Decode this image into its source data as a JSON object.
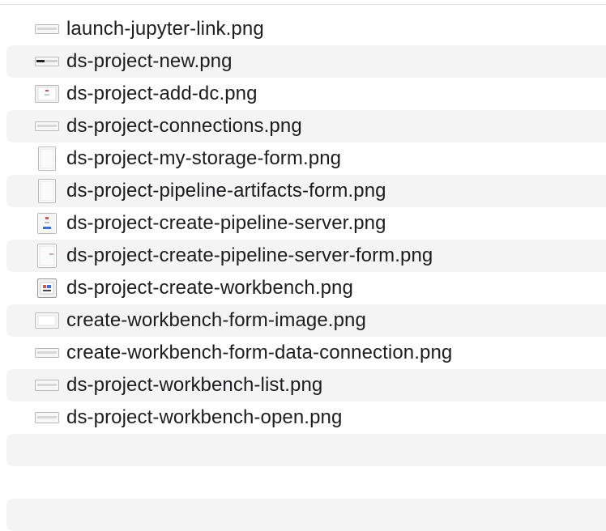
{
  "files": [
    {
      "name": "launch-jupyter-link.png",
      "icon": "wide-screenshot-thumbnail-icon"
    },
    {
      "name": "ds-project-new.png",
      "icon": "wide-dark-bar-thumbnail-icon"
    },
    {
      "name": "ds-project-add-dc.png",
      "icon": "dialog-thumbnail-icon"
    },
    {
      "name": "ds-project-connections.png",
      "icon": "wide-screenshot-thumbnail-icon"
    },
    {
      "name": "ds-project-my-storage-form.png",
      "icon": "tall-form-thumbnail-icon"
    },
    {
      "name": "ds-project-pipeline-artifacts-form.png",
      "icon": "tall-form-thumbnail-icon"
    },
    {
      "name": "ds-project-create-pipeline-server.png",
      "icon": "small-dialog-thumbnail-icon"
    },
    {
      "name": "ds-project-create-pipeline-server-form.png",
      "icon": "tall-form-thumbnail-icon"
    },
    {
      "name": "ds-project-create-workbench.png",
      "icon": "colorful-dialog-thumbnail-icon"
    },
    {
      "name": "create-workbench-form-image.png",
      "icon": "window-thumbnail-icon"
    },
    {
      "name": "create-workbench-form-data-connection.png",
      "icon": "wide-screenshot-thumbnail-icon"
    },
    {
      "name": "ds-project-workbench-list.png",
      "icon": "wide-screenshot-thumbnail-icon"
    },
    {
      "name": "ds-project-workbench-open.png",
      "icon": "wide-screenshot-thumbnail-icon"
    }
  ]
}
